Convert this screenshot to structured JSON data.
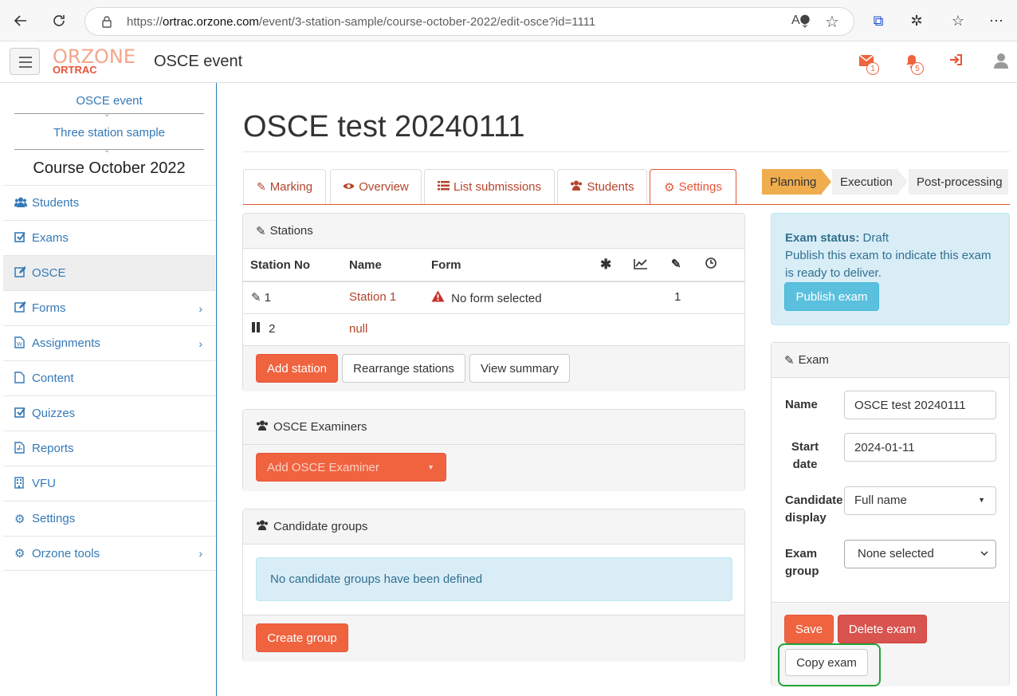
{
  "browser": {
    "url_prefix": "https://",
    "url_domain": "ortrac.orzone.com",
    "url_path": "/event/3-station-sample/course-october-2022/edit-osce?id=1111"
  },
  "app": {
    "logo_top": "ORZONE",
    "logo_bottom": "ORTRAC",
    "title": "OSCE event",
    "mail_count": "1",
    "notif_count": "5"
  },
  "sidebar": {
    "crumb1": "OSCE event",
    "crumb2": "Three station sample",
    "course": "Course October 2022",
    "items": [
      {
        "label": "Students",
        "icon": "users-icon"
      },
      {
        "label": "Exams",
        "icon": "check-square-icon"
      },
      {
        "label": "OSCE",
        "icon": "edit-icon"
      },
      {
        "label": "Forms",
        "icon": "edit-icon"
      },
      {
        "label": "Assignments",
        "icon": "word-file-icon"
      },
      {
        "label": "Content",
        "icon": "file-icon"
      },
      {
        "label": "Quizzes",
        "icon": "check-square-icon"
      },
      {
        "label": "Reports",
        "icon": "pdf-file-icon"
      },
      {
        "label": "VFU",
        "icon": "building-icon"
      },
      {
        "label": "Settings",
        "icon": "gears-icon"
      },
      {
        "label": "Orzone tools",
        "icon": "gears-icon"
      }
    ]
  },
  "main": {
    "title": "OSCE test 20240111",
    "tabs": [
      "Marking",
      "Overview",
      "List submissions",
      "Students",
      "Settings"
    ],
    "steps": [
      "Planning",
      "Execution",
      "Post-processing"
    ]
  },
  "stations": {
    "heading": "Stations",
    "columns": [
      "Station No",
      "Name",
      "Form"
    ],
    "rows": [
      {
        "no": "1",
        "name": "Station 1",
        "form": "No form selected",
        "count": "1"
      },
      {
        "no": "2",
        "name": "null",
        "form": "",
        "count": ""
      }
    ],
    "add_button": "Add station",
    "rearrange_button": "Rearrange stations",
    "summary_button": "View summary"
  },
  "examiners": {
    "heading": "OSCE Examiners",
    "add_button": "Add OSCE Examiner"
  },
  "groups": {
    "heading": "Candidate groups",
    "empty_message": "No candidate groups have been defined",
    "create_button": "Create group"
  },
  "status": {
    "label": "Exam status:",
    "value": "Draft",
    "description": "Publish this exam to indicate this exam is ready to deliver.",
    "publish_button": "Publish exam"
  },
  "exam_form": {
    "heading": "Exam",
    "name_label": "Name",
    "name_value": "OSCE test 20240111",
    "start_label": "Start date",
    "start_value": "2024-01-11",
    "display_label": "Candidate display",
    "display_value": "Full name",
    "group_label": "Exam group",
    "group_value": "None selected",
    "save_button": "Save",
    "delete_button": "Delete exam",
    "copy_button": "Copy exam"
  },
  "colors": {
    "accent": "#f0633f",
    "link": "#3479b7",
    "highlight": "#22a33b"
  }
}
